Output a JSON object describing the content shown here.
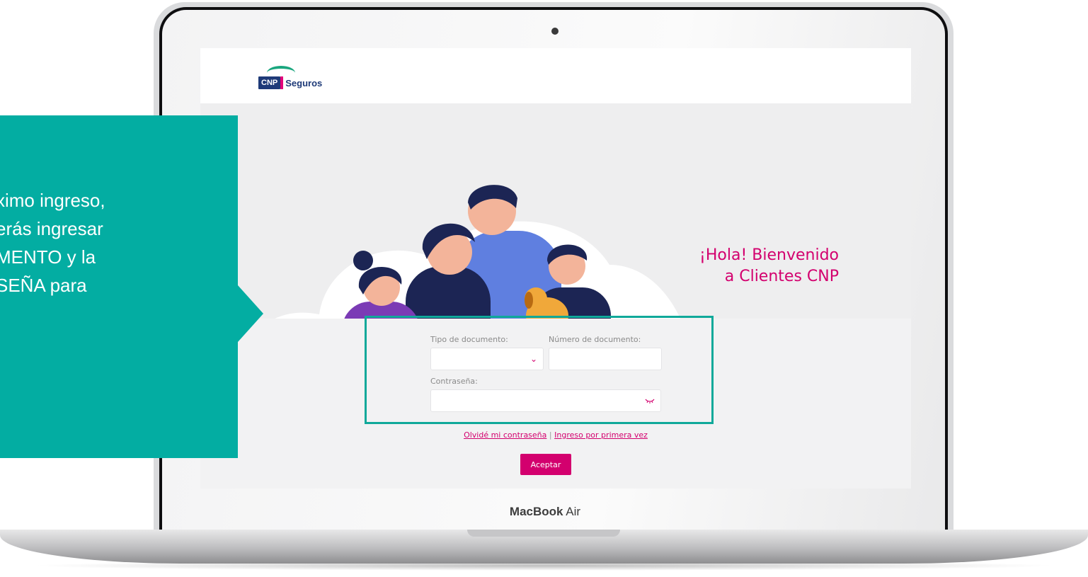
{
  "callout": {
    "lines": [
      "ximo ingreso,",
      "erás ingresar",
      "MENTO y la",
      "SEÑA para"
    ],
    "color": "#03ada2"
  },
  "logo": {
    "box_text": "CNP",
    "word": "Seguros"
  },
  "welcome": {
    "line1": "¡Hola! Bienvenido",
    "line2": "a Clientes CNP"
  },
  "form": {
    "doc_type_label": "Tipo de documento:",
    "doc_number_label": "Número de documento:",
    "password_label": "Contraseña:",
    "doc_type_value": "",
    "doc_number_value": "",
    "password_value": ""
  },
  "links": {
    "forgot": "Olvidé mi contraseña",
    "separator": "|",
    "first_time": "Ingreso por primera vez"
  },
  "accept_button": "Aceptar",
  "device": {
    "brand": "MacBook",
    "model": "Air"
  },
  "colors": {
    "accent": "#d3006e",
    "teal": "#03ada2",
    "navy": "#1e3a78"
  }
}
